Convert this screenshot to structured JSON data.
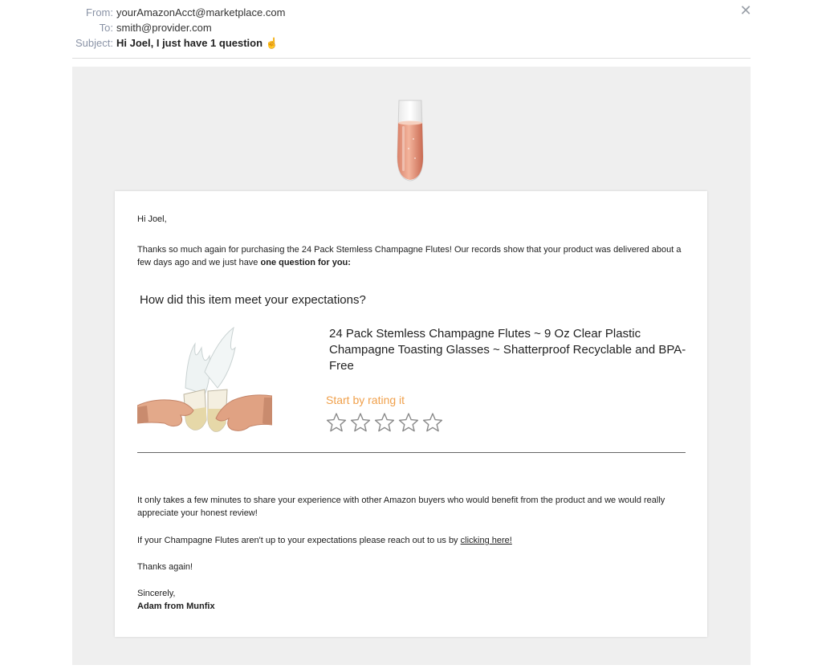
{
  "header": {
    "from_label": "From:",
    "from_value": "yourAmazonAcct@marketplace.com",
    "to_label": "To:",
    "to_value": "smith@provider.com",
    "subject_label": "Subject:",
    "subject_value": "Hi Joel, I just have 1 question",
    "subject_emoji": "☝",
    "close_icon": "close-icon"
  },
  "email": {
    "hero_icon": "champagne-flute-icon",
    "greeting": "Hi Joel,",
    "intro_text": "Thanks so much again for purchasing the 24 Pack Stemless Champagne Flutes! Our records show that your product was delivered about a few days ago and we just have",
    "intro_bold": "one question for you:",
    "question": "How did this item meet your expectations?",
    "product_title": "24 Pack Stemless Champagne Flutes ~ 9 Oz Clear Plastic Champagne Toasting Glasses ~ Shatterproof Recyclable and BPA-Free",
    "rating_prompt": "Start by rating it",
    "rating_max": 5,
    "rating_value": 0,
    "share_text": "It only takes a few minutes to share your experience with other Amazon buyers who would benefit from the product and we would really appreciate your honest review!",
    "reach_text": "If your Champagne Flutes aren't up to your expectations please reach out to us by",
    "reach_link": "clicking here!",
    "thanks": "Thanks again!",
    "sign_off": "Sincerely,",
    "signer": "Adam from Munfix"
  },
  "colors": {
    "rating_prompt": "#f0a04b",
    "canvas_bg": "#efefef",
    "header_label": "#8a93a6"
  }
}
